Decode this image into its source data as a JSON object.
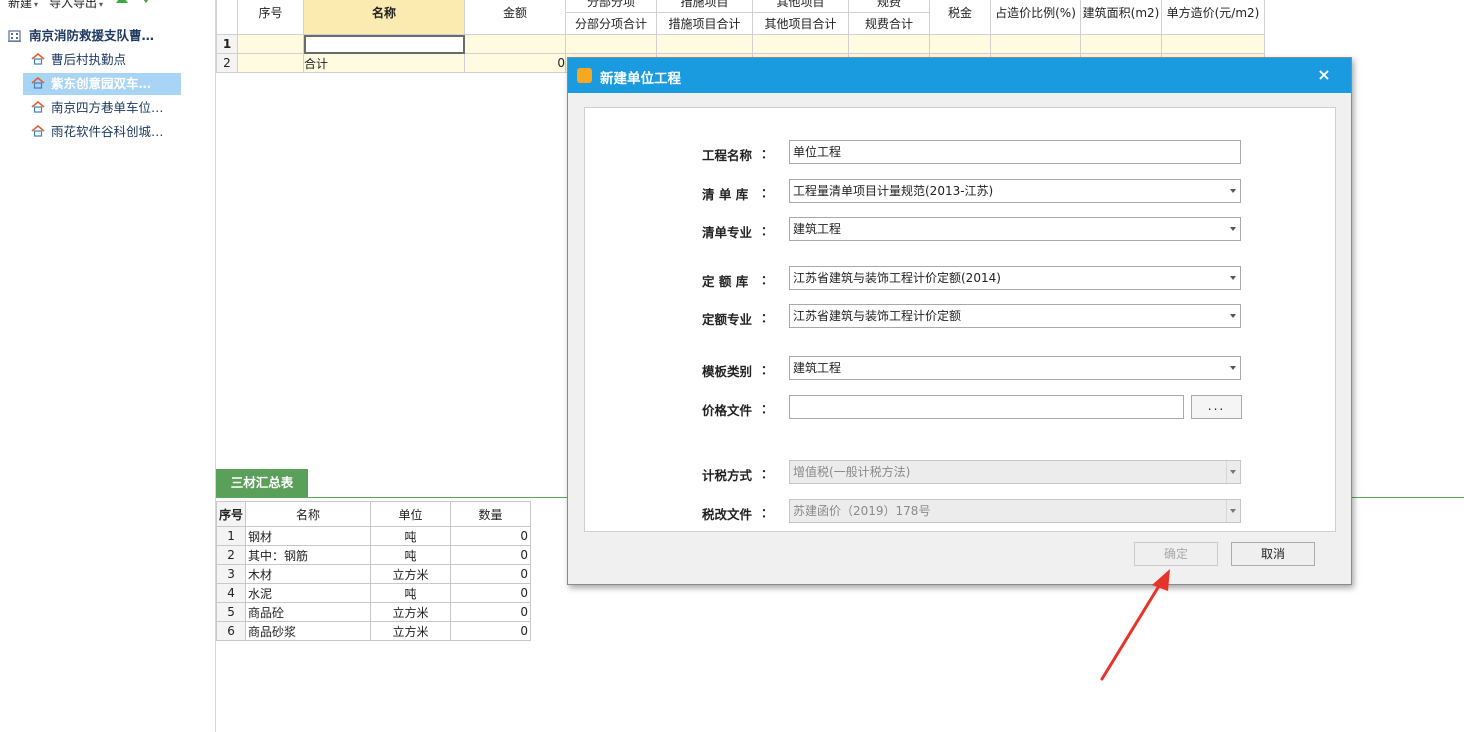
{
  "toolbar": {
    "new_label": "新建",
    "import_export_label": "导入导出"
  },
  "tree": {
    "root": "南京消防救援支队曹…",
    "items": [
      {
        "label": "曹后村执勤点",
        "selected": false
      },
      {
        "label": "紫东创意园双车…",
        "selected": true
      },
      {
        "label": "南京四方巷单车位…",
        "selected": false
      },
      {
        "label": "雨花软件谷科创城…",
        "selected": false
      }
    ]
  },
  "main_grid": {
    "headers_top": [
      "序号",
      "名称",
      "金额",
      "分部分项",
      "措施项目",
      "其他项目",
      "规费",
      "税金",
      "占造价比例(%)",
      "建筑面积(m2)",
      "单方造价(元/m2)"
    ],
    "headers_sub": [
      "分部分项合计",
      "措施项目合计",
      "其他项目合计",
      "规费合计"
    ],
    "rows": [
      {
        "num": "1",
        "name": "",
        "amount": ""
      },
      {
        "num": "2",
        "name": "合计",
        "amount": "0"
      }
    ]
  },
  "bottom_tab": {
    "label": "三材汇总表"
  },
  "summary_table": {
    "headers": [
      "序号",
      "名称",
      "单位",
      "数量"
    ],
    "rows": [
      {
        "idx": "1",
        "name": "钢材",
        "unit": "吨",
        "qty": "0"
      },
      {
        "idx": "2",
        "name": "其中：钢筋",
        "unit": "吨",
        "qty": "0"
      },
      {
        "idx": "3",
        "name": "木材",
        "unit": "立方米",
        "qty": "0"
      },
      {
        "idx": "4",
        "name": "水泥",
        "unit": "吨",
        "qty": "0"
      },
      {
        "idx": "5",
        "name": "商品砼",
        "unit": "立方米",
        "qty": "0"
      },
      {
        "idx": "6",
        "name": "商品砂浆",
        "unit": "立方米",
        "qty": "0"
      }
    ]
  },
  "dialog": {
    "title": "新建单位工程",
    "close_glyph": "×",
    "fields": {
      "project_name": {
        "label": "工程名称",
        "value": "单位工程"
      },
      "bill_library": {
        "label": "清 单 库",
        "value": "工程量清单项目计量规范(2013-江苏)"
      },
      "bill_specialty": {
        "label": "清单专业",
        "value": "建筑工程"
      },
      "quota_library": {
        "label": "定 额 库",
        "value": "江苏省建筑与装饰工程计价定额(2014)"
      },
      "quota_specialty": {
        "label": "定额专业",
        "value": "江苏省建筑与装饰工程计价定额"
      },
      "template_type": {
        "label": "模板类别",
        "value": "建筑工程"
      },
      "price_file": {
        "label": "价格文件",
        "value": ""
      },
      "tax_method": {
        "label": "计税方式",
        "value": "增值税(一般计税方法)"
      },
      "tax_reform_file": {
        "label": "税改文件",
        "value": "苏建函价（2019）178号"
      }
    },
    "colon": "：",
    "browse_label": "...",
    "ok_label": "确定",
    "cancel_label": "取消"
  },
  "colors": {
    "title_bar": "#1a9be0",
    "tab_green": "#5aa05a",
    "selection": "#a8d4f5",
    "annotation": "#e8332a"
  }
}
